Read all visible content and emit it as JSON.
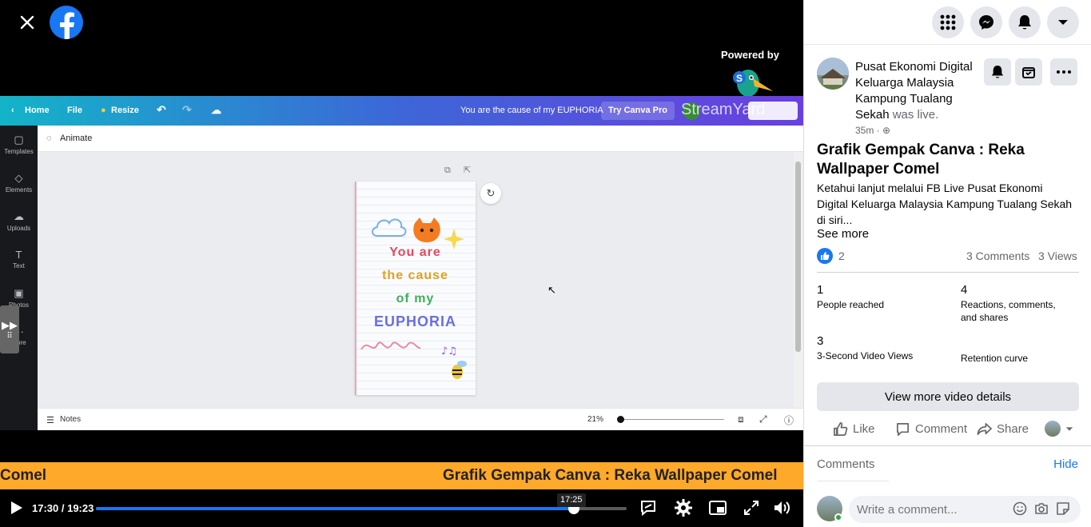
{
  "video": {
    "powered_by": "Powered by",
    "streamyard": "StreamYard",
    "canva": {
      "home": "Home",
      "file": "File",
      "resize": "Resize",
      "doc_title": "You are the cause of my EUPHORIA",
      "try_pro": "Try Canva Pro",
      "animate": "Animate",
      "tools": [
        "Templates",
        "Elements",
        "Uploads",
        "Text",
        "Photos",
        "More"
      ],
      "design_lines": [
        "You are",
        "the cause",
        "of my",
        "EUPHORIA"
      ],
      "notes": "Notes",
      "zoom": "21%"
    },
    "ticker_left": "Comel",
    "ticker_right": "Grafik Gempak Canva : Reka Wallpaper Comel",
    "time_display": "17:30 / 19:23",
    "hover_time": "17:25",
    "progress": 0.9
  },
  "panel": {
    "page_name": "Pusat Ekonomi Digital Keluarga Malaysia Kampung Tualang Sekah",
    "was_live": "was live.",
    "time_ago": "35m ·",
    "title": "Grafik Gempak Canva : Reka Wallpaper Comel",
    "description": "Ketahui lanjut melalui FB Live Pusat Ekonomi Digital Keluarga Malaysia Kampung Tualang Sekah di siri...",
    "see_more": "See more",
    "reaction_count": "2",
    "comments_count": "3 Comments",
    "views_count": "3 Views",
    "stats": [
      {
        "value": "1",
        "label": "People reached"
      },
      {
        "value": "4",
        "label": "Reactions, comments, and shares"
      },
      {
        "value": "3",
        "label": "3-Second Video Views"
      },
      {
        "value": "",
        "label": "Retention curve"
      }
    ],
    "view_more": "View more video details",
    "actions": {
      "like": "Like",
      "comment": "Comment",
      "share": "Share"
    },
    "comments_header": "Comments",
    "hide": "Hide",
    "comment_placeholder": "Write a comment..."
  },
  "colors": {
    "brand": "#1877f2",
    "ticker": "#ffa92a"
  }
}
